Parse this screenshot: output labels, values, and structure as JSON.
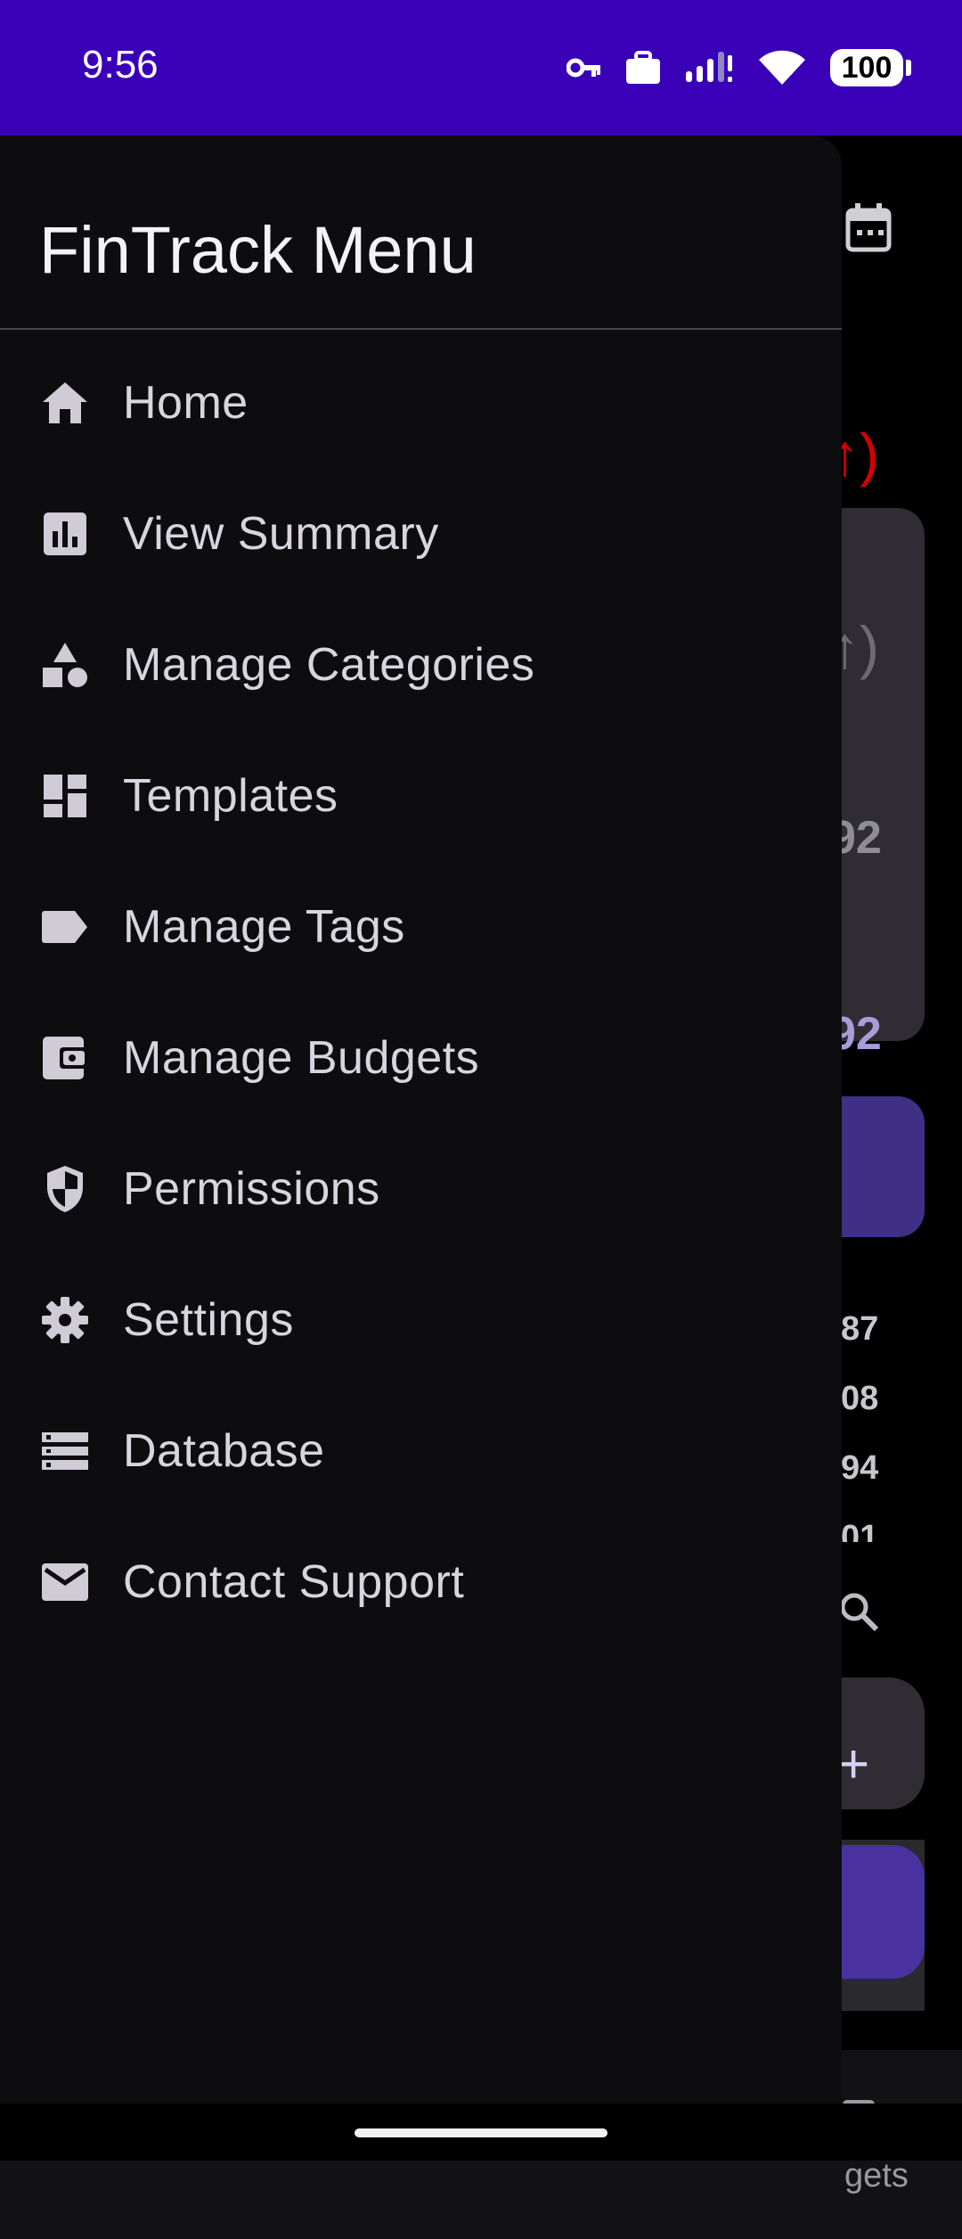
{
  "status_bar": {
    "time": "9:56",
    "battery": "100",
    "icons": [
      "vpn-key-icon",
      "work-profile-icon",
      "signal-icon",
      "wifi-icon",
      "battery-icon"
    ]
  },
  "drawer": {
    "title": "FinTrack Menu",
    "items": [
      {
        "label": "Home",
        "icon": "home-icon"
      },
      {
        "label": "View Summary",
        "icon": "bar-chart-icon"
      },
      {
        "label": "Manage Categories",
        "icon": "category-shapes-icon"
      },
      {
        "label": "Templates",
        "icon": "dashboard-icon"
      },
      {
        "label": "Manage Tags",
        "icon": "label-tag-icon"
      },
      {
        "label": "Manage Budgets",
        "icon": "wallet-icon"
      },
      {
        "label": "Permissions",
        "icon": "shield-icon"
      },
      {
        "label": "Settings",
        "icon": "gear-icon"
      },
      {
        "label": "Database",
        "icon": "storage-list-icon"
      },
      {
        "label": "Contact Support",
        "icon": "mail-icon"
      }
    ]
  },
  "background": {
    "card1_top": "↑)",
    "card1_mid": "↑)",
    "card1_bottom": "92",
    "card2_value": "92",
    "list_values": [
      "87",
      "08",
      "94",
      "01"
    ],
    "nav_label": "gets",
    "fab_label": "+"
  },
  "colors": {
    "status_bar": "#3a00b8",
    "drawer": "#0d0d10",
    "accent_red": "#d40000",
    "accent_purple": "#3f3085"
  }
}
